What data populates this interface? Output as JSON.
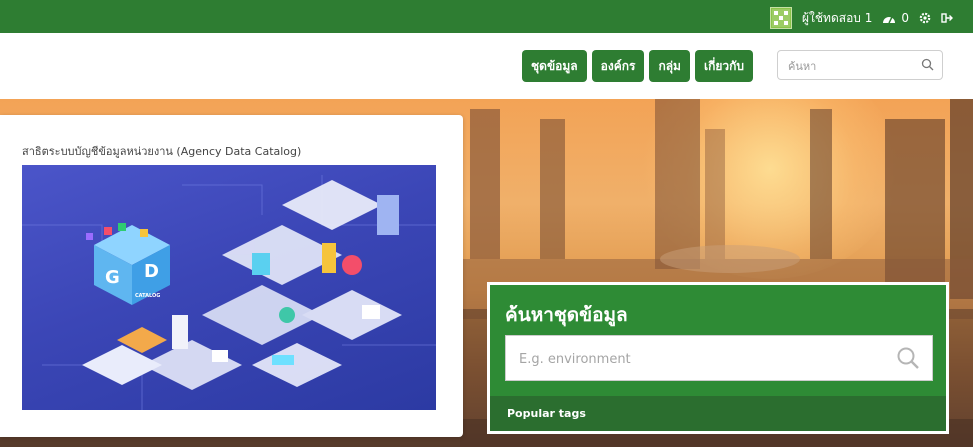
{
  "topbar": {
    "user_name": "ผู้ใช้ทดสอบ 1",
    "notification_count": "0"
  },
  "nav": {
    "datasets": "ชุดข้อมูล",
    "organizations": "องค์กร",
    "groups": "กลุ่ม",
    "about": "เกี่ยวกับ"
  },
  "search": {
    "placeholder": "ค้นหา"
  },
  "card": {
    "title": "สาธิตระบบบัญชีข้อมูลหน่วยงาน (Agency Data Catalog)",
    "logo_letters": [
      "G",
      "D"
    ],
    "logo_caption": "CATALOG"
  },
  "dataset_search": {
    "title": "ค้นหาชุดข้อมูล",
    "placeholder": "E.g. environment",
    "popular_tags_label": "Popular tags"
  },
  "colors": {
    "brand_green": "#2e7d32",
    "panel_green": "#2e8b35",
    "panel_footer": "#2b6e2f"
  },
  "icons": [
    "user-avatar-icon",
    "dashboard-icon",
    "gear-icon",
    "logout-icon",
    "search-icon"
  ]
}
